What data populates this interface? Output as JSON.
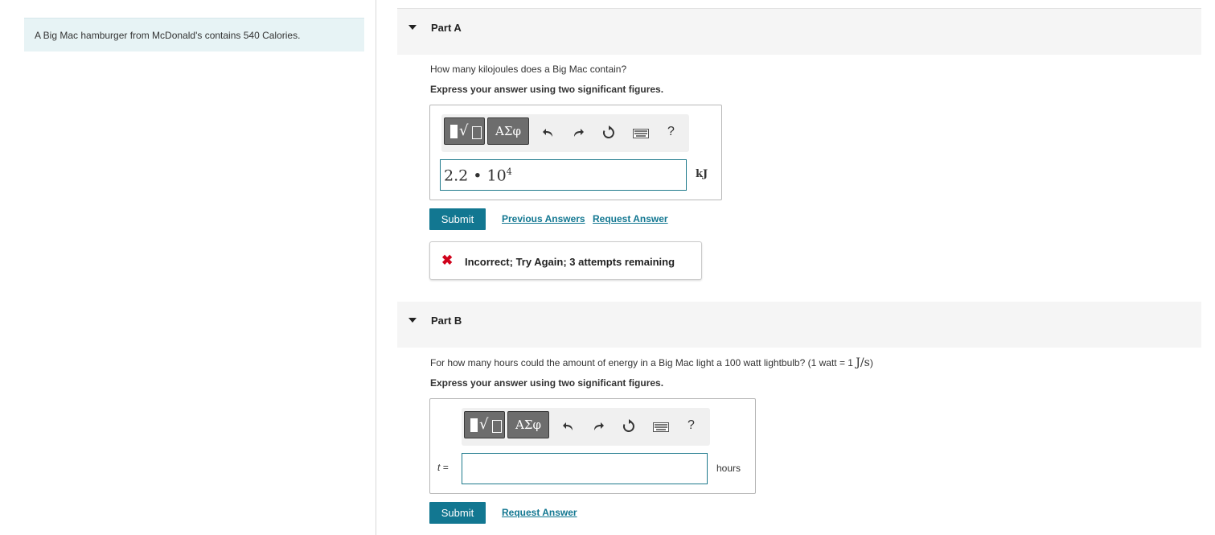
{
  "intro": {
    "text": "A Big Mac hamburger from McDonald's contains 540 Calories."
  },
  "toolbar_labels": {
    "template": "√",
    "greek": "ΑΣφ",
    "help": "?"
  },
  "icons": [
    "caret-down-icon",
    "template-icon",
    "greek-symbols-icon",
    "undo-icon",
    "redo-icon",
    "reset-icon",
    "keyboard-icon",
    "help-icon",
    "incorrect-x-icon"
  ],
  "colors": {
    "accent": "#127791",
    "error": "#d0021b",
    "intro_bg": "#e7f3f5"
  },
  "partA": {
    "title": "Part A",
    "question": "How many kilojoules does a Big Mac contain?",
    "instruction": "Express your answer using two significant figures.",
    "answer_mantissa": "2.2",
    "answer_dot": "•",
    "answer_base": "10",
    "answer_exponent": "4",
    "unit": "kJ",
    "submit_label": "Submit",
    "previous_answers_label": "Previous Answers",
    "request_answer_label": "Request Answer",
    "feedback_text": "Incorrect; Try Again; 3 attempts remaining"
  },
  "partB": {
    "title": "Part B",
    "question_prefix": "For how many hours could the amount of energy in a Big Mac light a 100 watt lightbulb? (1 watt = 1 ",
    "question_unit": "J/s",
    "question_suffix": ")",
    "instruction": "Express your answer using two significant figures.",
    "variable_label": "t =",
    "answer_value": "",
    "unit": "hours",
    "submit_label": "Submit",
    "request_answer_label": "Request Answer"
  }
}
